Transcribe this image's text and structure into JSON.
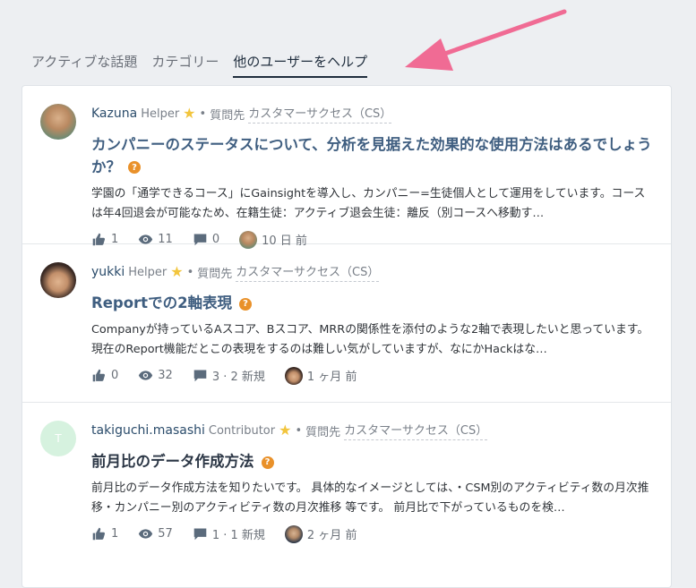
{
  "tabs": [
    "アクティブな話題",
    "カテゴリー",
    "他のユーザーをヘルプ"
  ],
  "active_tab": 2,
  "posts": [
    {
      "author": "Kazuna",
      "role": "Helper",
      "asked_label": "質問先",
      "category": "カスタマーサクセス（CS）",
      "title": "カンパニーのステータスについて、分析を見据えた効果的な使用方法はあるでしょうか？",
      "excerpt": "学園の「通学できるコース」にGainsightを導入し、カンパニー=生徒個人として運用をしています。コースは年4回退会が可能なため、在籍生徒：アクティブ退会生徒：離反（別コースへ移動す…",
      "likes": "1",
      "views": "11",
      "replies": "0",
      "time": "10 日 前"
    },
    {
      "author": "yukki",
      "role": "Helper",
      "asked_label": "質問先",
      "category": "カスタマーサクセス（CS）",
      "title": "Reportでの2軸表現",
      "excerpt": "Companyが持っているAスコア、Bスコア、MRRの関係性を添付のような2軸で表現したいと思っています。現在のReport機能だとこの表現をするのは難しい気がしていますが、なにかHackはな…",
      "likes": "0",
      "views": "32",
      "replies": "3 · 2 新規",
      "time": "1 ヶ月 前"
    },
    {
      "author": "takiguchi.masashi",
      "role": "Contributor",
      "asked_label": "質問先",
      "category": "カスタマーサクセス（CS）",
      "avatar_letter": "T",
      "title": "前月比のデータ作成方法",
      "excerpt": "前月比のデータ作成方法を知りたいです。 具体的なイメージとしては、・CSM別のアクティビティ数の月次推移・カンパニー別のアクティビティ数の月次推移 等です。 前月比で下がっているものを検…",
      "likes": "1",
      "views": "57",
      "replies": "1 · 1 新規",
      "time": "2 ヶ月 前"
    }
  ],
  "colors": {
    "accent": "#3f5e80",
    "badge": "#e9912a",
    "arrow": "#f06b94",
    "background": "#edeff2"
  },
  "icons": [
    "thumbs-up-icon",
    "eye-icon",
    "comment-icon",
    "question-badge-icon",
    "star-icon"
  ]
}
